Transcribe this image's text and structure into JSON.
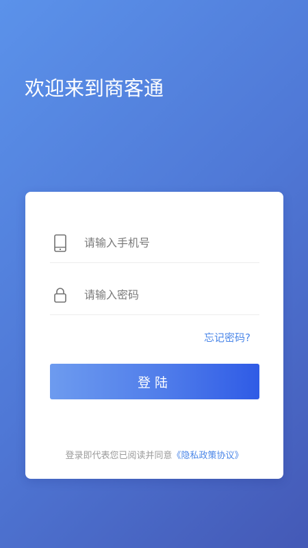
{
  "header": {
    "welcome_title": "欢迎来到商客通"
  },
  "form": {
    "phone_placeholder": "请输入手机号",
    "password_placeholder": "请输入密码",
    "forgot_password": "忘记密码?",
    "login_label": "登陆"
  },
  "agreement": {
    "prefix_text": "登录即代表您已阅读并同意",
    "policy_link": "《隐私政策协议》"
  },
  "icons": {
    "phone": "phone-icon",
    "lock": "lock-icon"
  },
  "colors": {
    "accent": "#4a86e8",
    "button_start": "#6d9bef",
    "button_end": "#2f5be6",
    "background_start": "#5b92ea",
    "background_end": "#4459b6"
  }
}
